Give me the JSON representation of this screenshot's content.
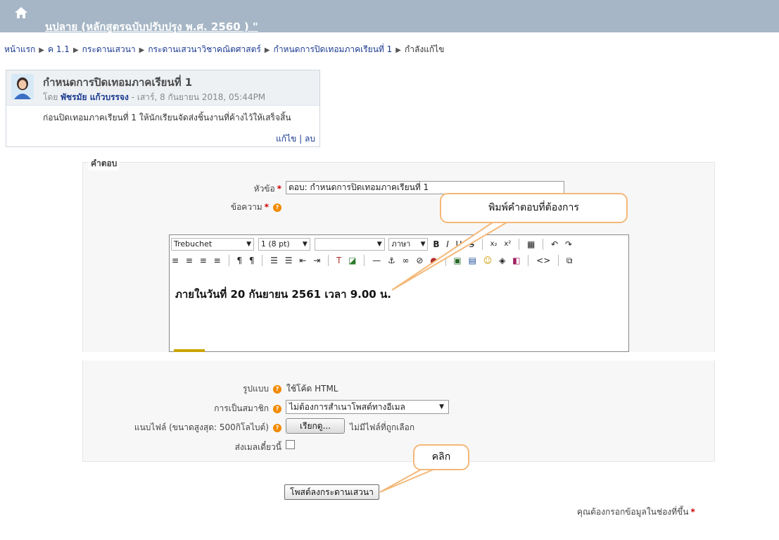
{
  "header": {
    "home_icon": "home-icon",
    "course_title": "นปลาย (หลักสูตรฉบับปรับปรุง พ.ศ. 2560 ) \""
  },
  "breadcrumb": {
    "items": [
      "หน้าแรก",
      "ค 1.1",
      "กระดานเสวนา",
      "กระดานเสวนาวิชาคณิตศาสตร์",
      "กำหนดการปิดเทอมภาคเรียนที่ 1"
    ],
    "current": "กำลังแก้ไข",
    "separator": "▶"
  },
  "post": {
    "subject": "กำหนดการปิดเทอมภาคเรียนที่ 1",
    "by_prefix": "โดย",
    "author": "พัชรมัย แก้วบรรจง",
    "date": "- เสาร์, 8 กันยายน 2018, 05:44PM",
    "message": "ก่อนปิดเทอมภาคเรียนที่ 1 ให้นักเรียนจัดส่งชิ้นงานที่ค้างไว้ให้เสร็จสิ้น",
    "edit_link": "แก้ไข",
    "action_sep": "|",
    "delete_link": "ลบ"
  },
  "form": {
    "legend": "คำตอบ",
    "subject_label": "หัวข้อ",
    "subject_value": "ตอบ: กำหนดการปิดเทอมภาคเรียนที่ 1",
    "message_label": "ข้อความ",
    "required_mark": "*",
    "format_label": "รูปแบบ",
    "format_value": "ใช้โค้ด HTML",
    "subscribe_label": "การเป็นสมาชิก",
    "subscribe_value": "ไม่ต้องการสำเนาโพสต์ทางอีเมล",
    "attach_label": "แนบไฟล์ (ขนาดสูงสุด: 500กิโลไบต์)",
    "browse_button": "เรียกดู...",
    "no_file_text": "ไม่มีไฟล์ที่ถูกเลือก",
    "mailnow_label": "ส่งเมลเดี๋ยวนี้",
    "submit_button": "โพสต์ลงกระดานเสวนา",
    "required_note": "คุณต้องกรอกข้อมูลในช่องที่ขึ้น",
    "help_icon": "?"
  },
  "editor": {
    "font_family": "Trebuchet",
    "font_size": "1 (8 pt)",
    "style_value": "",
    "language": "ภาษา",
    "content": "ภายในวันที่ 20 กันยายน 2561 เวลา 9.00 น."
  },
  "annotations": {
    "callout_type": "พิมพ์คำตอบที่ต้องการ",
    "callout_click": "คลิก"
  },
  "colors": {
    "header_bg": "#a6b6c6",
    "link": "#1a3a8f",
    "help_orange": "#f28a00",
    "callout_border": "#f4b878"
  }
}
